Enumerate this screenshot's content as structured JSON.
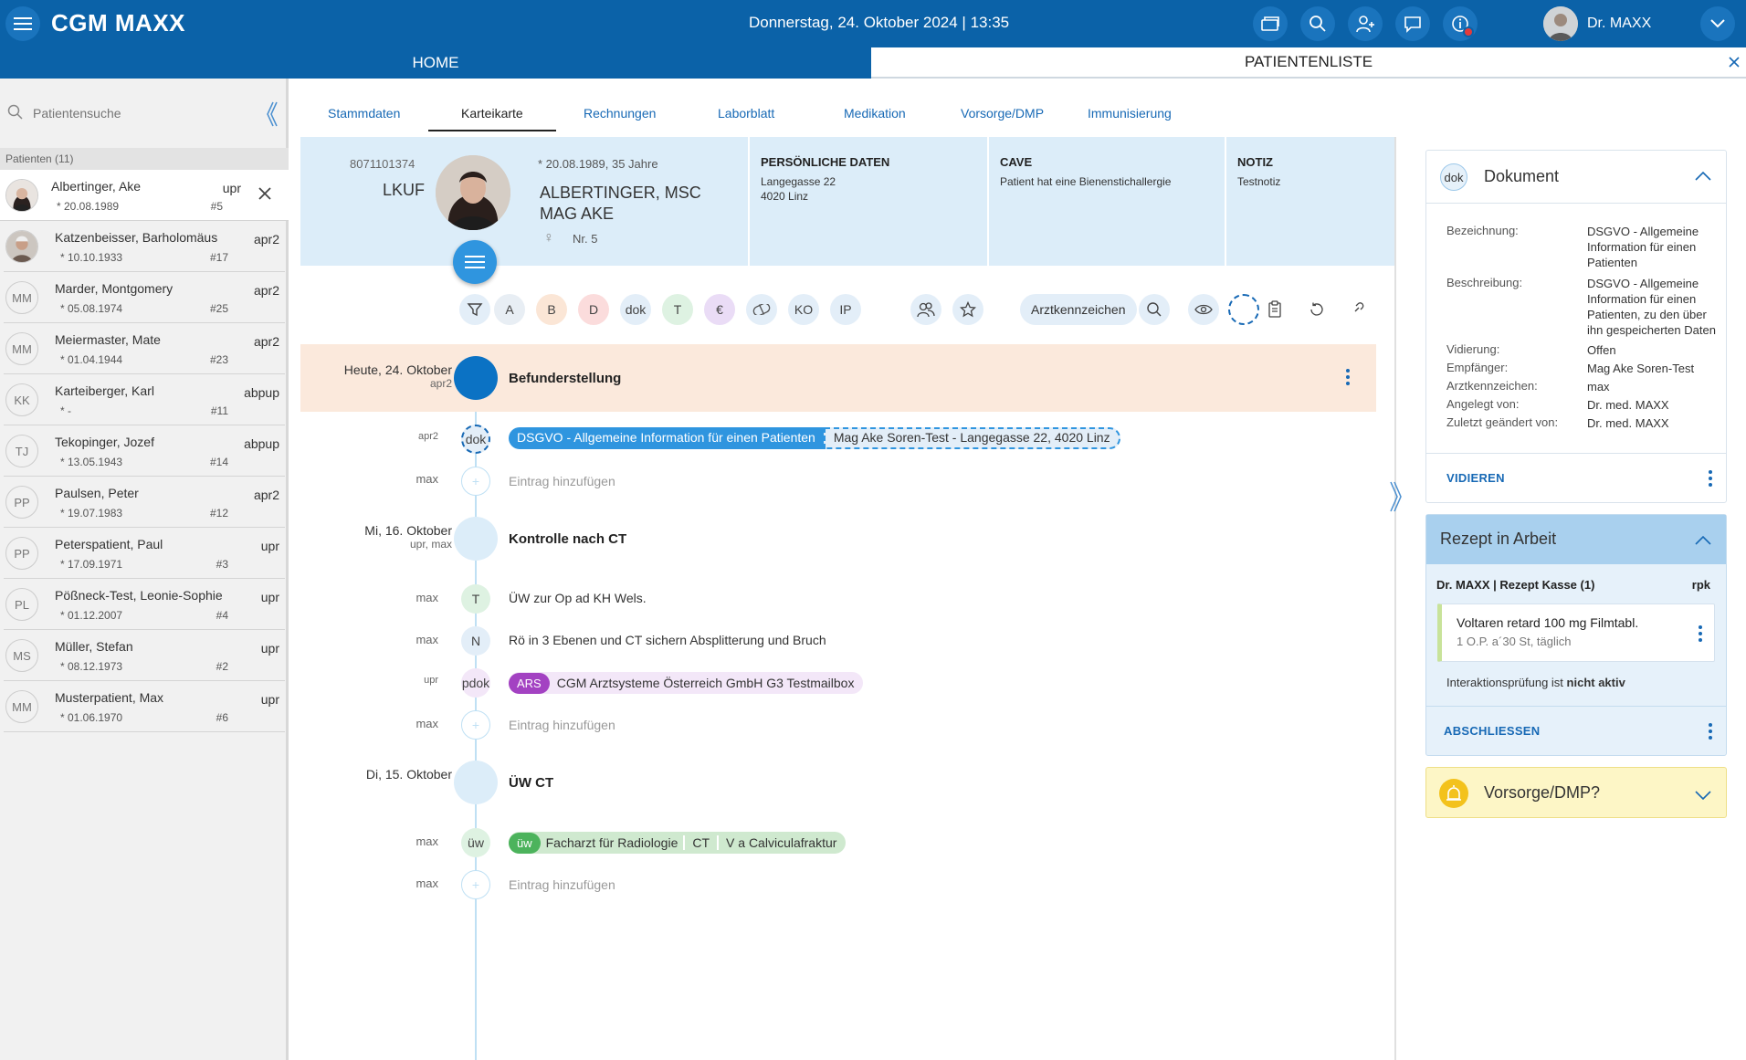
{
  "topbar": {
    "logo": "CGM MAXX",
    "datetime": "Donnerstag, 24. Oktober 2024 | 13:35",
    "user_name": "Dr. MAXX"
  },
  "tabs": {
    "home": "HOME",
    "patientenliste": "PATIENTENLISTE"
  },
  "sidebar": {
    "search_placeholder": "Patientensuche",
    "count_label": "Patienten (11)",
    "patients": [
      {
        "initials": "",
        "name": "Albertinger, Ake",
        "dob": "* 20.08.1989",
        "tag": "upr",
        "num": "#5"
      },
      {
        "initials": "",
        "name": "Katzenbeisser, Barholomäus",
        "dob": "* 10.10.1933",
        "tag": "apr2",
        "num": "#17"
      },
      {
        "initials": "MM",
        "name": "Marder, Montgomery",
        "dob": "* 05.08.1974",
        "tag": "apr2",
        "num": "#25"
      },
      {
        "initials": "MM",
        "name": "Meiermaster, Mate",
        "dob": "* 01.04.1944",
        "tag": "apr2",
        "num": "#23"
      },
      {
        "initials": "KK",
        "name": "Karteiberger, Karl",
        "dob": "* -",
        "tag": "abpup",
        "num": "#11"
      },
      {
        "initials": "TJ",
        "name": "Tekopinger, Jozef",
        "dob": "* 13.05.1943",
        "tag": "abpup",
        "num": "#14"
      },
      {
        "initials": "PP",
        "name": "Paulsen, Peter",
        "dob": "* 19.07.1983",
        "tag": "apr2",
        "num": "#12"
      },
      {
        "initials": "PP",
        "name": "Peterspatient, Paul",
        "dob": "* 17.09.1971",
        "tag": "upr",
        "num": "#3"
      },
      {
        "initials": "PL",
        "name": "Pößneck-Test, Leonie-Sophie",
        "dob": "* 01.12.2007",
        "tag": "upr",
        "num": "#4"
      },
      {
        "initials": "MS",
        "name": "Müller, Stefan",
        "dob": "* 08.12.1973",
        "tag": "upr",
        "num": "#2"
      },
      {
        "initials": "MM",
        "name": "Musterpatient, Max",
        "dob": "* 01.06.1970",
        "tag": "upr",
        "num": "#6"
      }
    ]
  },
  "subtabs": [
    "Stammdaten",
    "Karteikarte",
    "Rechnungen",
    "Laborblatt",
    "Medikation",
    "Vorsorge/DMP",
    "Immunisierung"
  ],
  "patient": {
    "id": "8071101374",
    "code": "LKUF",
    "dob_age": "* 20.08.1989, 35 Jahre",
    "name_line1": "ALBERTINGER, MSC",
    "name_line2": "MAG AKE",
    "gender_symbol": "♀",
    "nr": "Nr. 5",
    "personal_title": "PERSÖNLICHE DATEN",
    "address1": "Langegasse 22",
    "address2": "4020 Linz",
    "cave_title": "CAVE",
    "cave_text": "Patient hat eine Bienenstichallergie",
    "notiz_title": "NOTIZ",
    "notiz_text": "Testnotiz"
  },
  "filters": {
    "chips": [
      "A",
      "B",
      "D",
      "dok",
      "T",
      "€",
      "KO",
      "IP"
    ],
    "arztkennzeichen": "Arztkennzeichen"
  },
  "timeline": {
    "day1": {
      "date": "Heute, 24. Oktober",
      "who": "apr2",
      "title": "Befunderstellung"
    },
    "e1": {
      "author": "apr2",
      "node": "dok",
      "pill1": "DSGVO - Allgemeine Information für einen Patienten",
      "pill2": "Mag Ake Soren-Test - Langegasse 22, 4020 Linz"
    },
    "e2": {
      "author": "max",
      "text": "Eintrag hinzufügen"
    },
    "day2": {
      "date": "Mi, 16. Oktober",
      "who": "upr, max",
      "title": "Kontrolle nach CT"
    },
    "e3": {
      "author": "max",
      "node": "T",
      "text": "ÜW zur Op ad KH Wels."
    },
    "e4": {
      "author": "max",
      "node": "N",
      "text": "Rö in 3 Ebenen und CT sichern Absplitterung und Bruch"
    },
    "e5": {
      "author": "upr",
      "node": "pdok",
      "badge": "ARS",
      "text": "CGM Arztsysteme Österreich GmbH G3 Testmailbox"
    },
    "e6": {
      "author": "max",
      "text": "Eintrag hinzufügen"
    },
    "day3": {
      "date": "Di, 15. Oktober",
      "title": "ÜW CT"
    },
    "e7": {
      "author": "max",
      "node": "üw",
      "badge": "üw",
      "t1": "Facharzt für Radiologie",
      "t2": "CT",
      "t3": "V a Calviculafraktur"
    },
    "e8": {
      "author": "max",
      "text": "Eintrag hinzufügen"
    }
  },
  "document_card": {
    "icon": "dok",
    "title": "Dokument",
    "rows": [
      {
        "k": "Bezeichnung:",
        "v": "DSGVO - Allgemeine Information für einen Patienten"
      },
      {
        "k": "Beschreibung:",
        "v": "DSGVO - Allgemeine Information für einen Patienten, zu den über ihn gespeicherten Daten"
      },
      {
        "k": "Vidierung:",
        "v": "Offen"
      },
      {
        "k": "Empfänger:",
        "v": "Mag Ake Soren-Test"
      },
      {
        "k": "Arztkennzeichen:",
        "v": "max"
      },
      {
        "k": "Angelegt von:",
        "v": "Dr. med. MAXX"
      },
      {
        "k": "Zuletzt geändert von:",
        "v": "Dr. med. MAXX"
      }
    ],
    "action": "VIDIEREN"
  },
  "rezept_card": {
    "title": "Rezept in Arbeit",
    "header": "Dr. MAXX | Rezept Kasse (1)",
    "code": "rpk",
    "drug": "Voltaren retard 100 mg Filmtabl.",
    "dosage": "1 O.P. a´30 St, täglich",
    "interaction_prefix": "Interaktionsprüfung ist ",
    "interaction_state": "nicht aktiv",
    "action": "ABSCHLIESSEN"
  },
  "vorsorge_card": {
    "title": "Vorsorge/DMP?"
  },
  "colors": {
    "brand": "#0b62a8",
    "accent": "#2f95df",
    "link": "#1769b5"
  }
}
